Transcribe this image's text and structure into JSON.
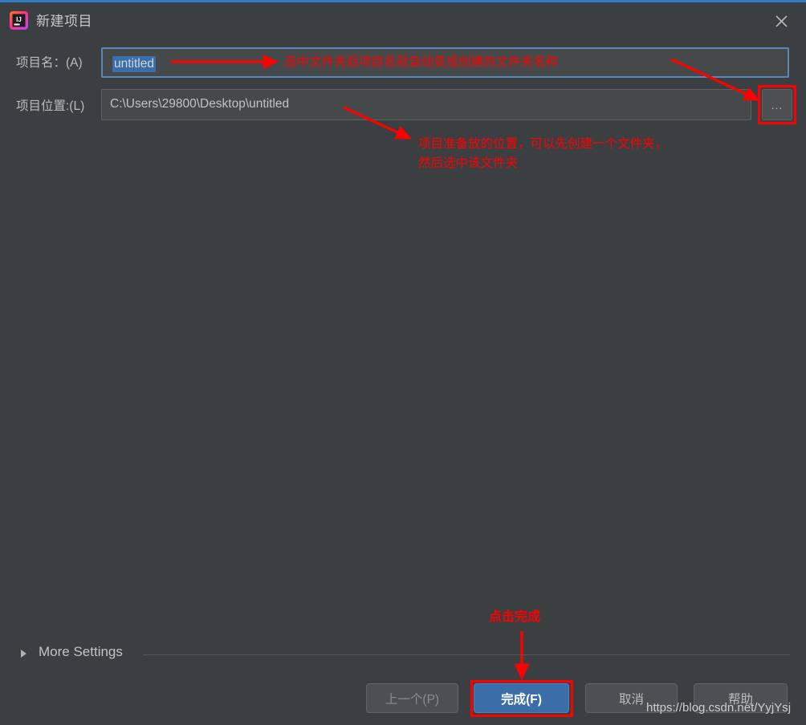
{
  "window": {
    "title": "新建项目",
    "app_icon": "intellij-idea-icon",
    "close_icon": "close-icon",
    "accent_color": "#2f7dc4",
    "background_color": "#3c3f41"
  },
  "form": {
    "project_name": {
      "label": "项目名：(A)",
      "value": "untitled",
      "selected": true,
      "focus_border_color": "#5a87b8",
      "selection_color": "#3b6ea8"
    },
    "project_location": {
      "label": "项目位置:(L)",
      "value": "C:\\Users\\29800\\Desktop\\untitled",
      "browse_button_label": "...",
      "browse_icon": "ellipsis-icon"
    }
  },
  "more_settings": {
    "label": "More Settings",
    "expander_icon": "chevron-right-icon",
    "expanded": false
  },
  "buttons": {
    "previous": {
      "label": "上一个(P)",
      "enabled": false
    },
    "finish": {
      "label": "完成(F)",
      "enabled": true,
      "default": true,
      "color": "#3b6ea8"
    },
    "cancel": {
      "label": "取消",
      "enabled": true
    },
    "help": {
      "label": "帮助",
      "enabled": true
    }
  },
  "annotations": {
    "color": "#ff0000",
    "name_field_note": "选中文件夹后项目名就自动变成创建的文件夹名称",
    "location_note_line1": "项目准备放的位置，可以先创建一个文件夹，",
    "location_note_line2": "然后选中该文件夹",
    "finish_note": "点击完成",
    "highlight_boxes": [
      "browse-button",
      "finish-button"
    ],
    "arrows": [
      "name-field-to-note",
      "note-to-browse-button",
      "location-field-to-note",
      "finish-note-to-finish-button"
    ]
  },
  "watermark": {
    "text": "https://blog.csdn.net/YyjYsj"
  }
}
